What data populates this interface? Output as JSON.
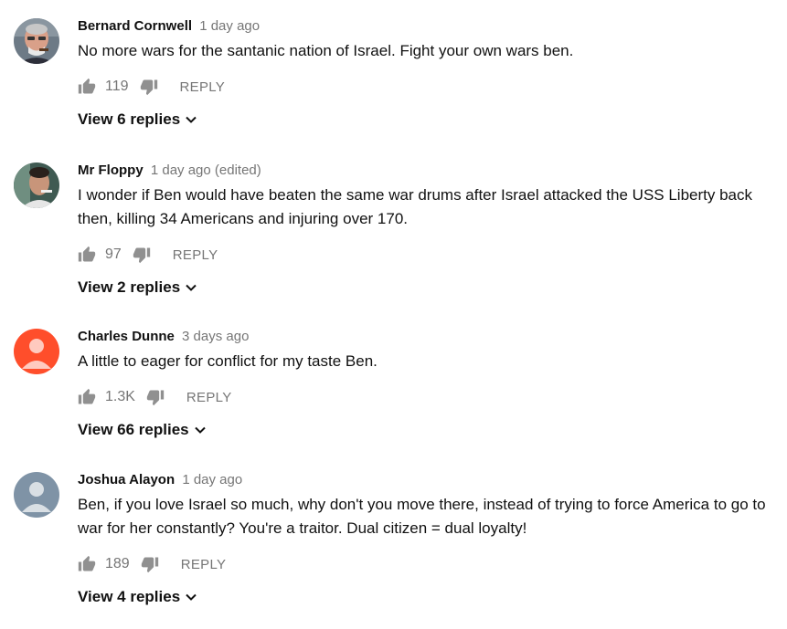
{
  "comments": [
    {
      "author": "Bernard Cornwell",
      "time": "1 day ago",
      "text": "No more wars for the santanic nation of Israel. Fight your own wars ben.",
      "likes": "119",
      "reply_label": "REPLY",
      "view_replies": "View 6 replies",
      "avatar": "photo-older-man"
    },
    {
      "author": "Mr Floppy",
      "time": "1 day ago (edited)",
      "text": "I wonder if Ben would have beaten the same war drums after Israel attacked the USS Liberty back then, killing 34 Americans and injuring over 170.",
      "likes": "97",
      "reply_label": "REPLY",
      "view_replies": "View 2 replies",
      "avatar": "photo-man"
    },
    {
      "author": "Charles Dunne",
      "time": "3 days ago",
      "text": "A little to eager for conflict for my taste Ben.",
      "likes": "1.3K",
      "reply_label": "REPLY",
      "view_replies": "View 66 replies",
      "avatar": "default-avatar",
      "avatar_color": "#ff4e2b"
    },
    {
      "author": "Joshua Alayon",
      "time": "1 day ago",
      "text": "Ben, if you love Israel so much, why don't you move there, instead of trying to force America to go to war for her constantly? You're a traitor. Dual citizen = dual loyalty!",
      "likes": "189",
      "reply_label": "REPLY",
      "view_replies": "View 4 replies",
      "avatar": "default-avatar",
      "avatar_color": "#7f93a6"
    }
  ],
  "colors": {
    "text": "#111111",
    "meta": "#767676",
    "icon": "#909090"
  }
}
